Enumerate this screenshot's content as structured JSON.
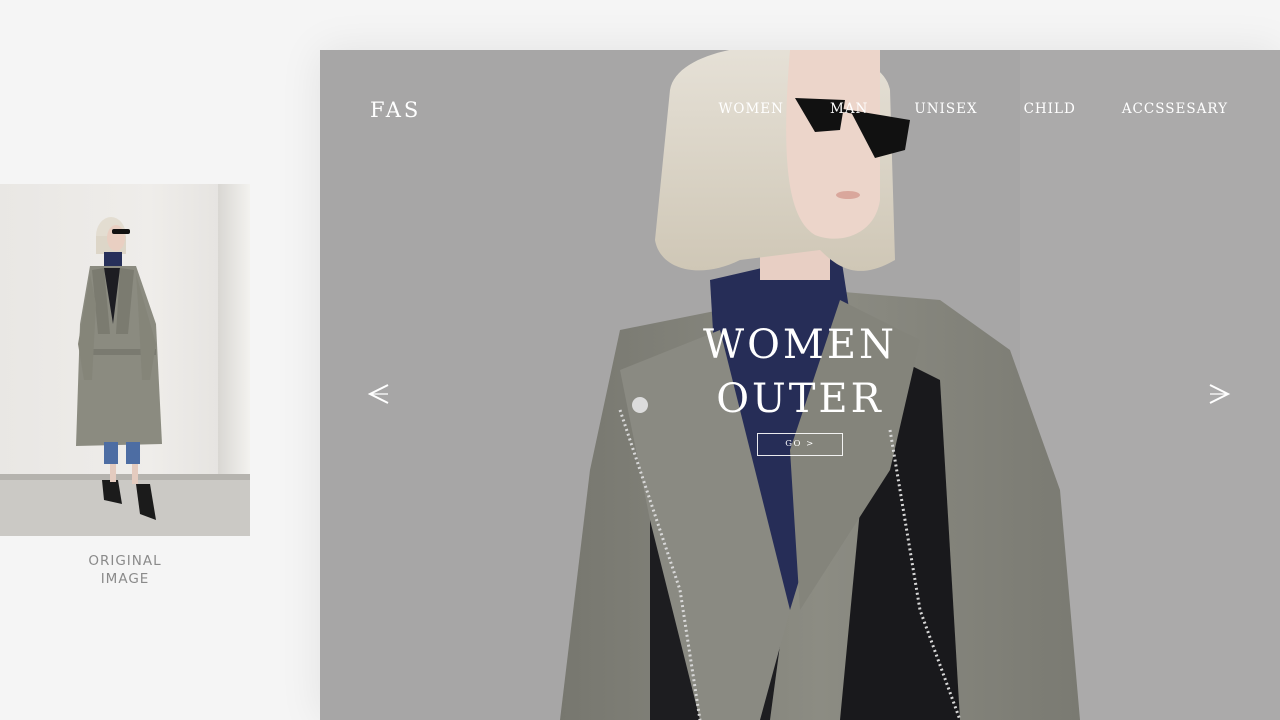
{
  "preview": {
    "caption_line1": "ORIGINAL",
    "caption_line2": "IMAGE"
  },
  "header": {
    "brand": "FAS",
    "nav": [
      "WOMEN",
      "MAN",
      "UNISEX",
      "CHILD",
      "ACCSSESARY"
    ]
  },
  "hero": {
    "title_line1": "WOMEN",
    "title_line2": "OUTER",
    "button_label": "GO >",
    "prev_icon": "chevron-left-icon",
    "next_icon": "chevron-right-icon"
  },
  "colors": {
    "page_bg": "#f5f5f5",
    "hero_bg": "#a5a5a5",
    "text_on_hero": "#ffffff",
    "caption": "#8a8a8a"
  }
}
